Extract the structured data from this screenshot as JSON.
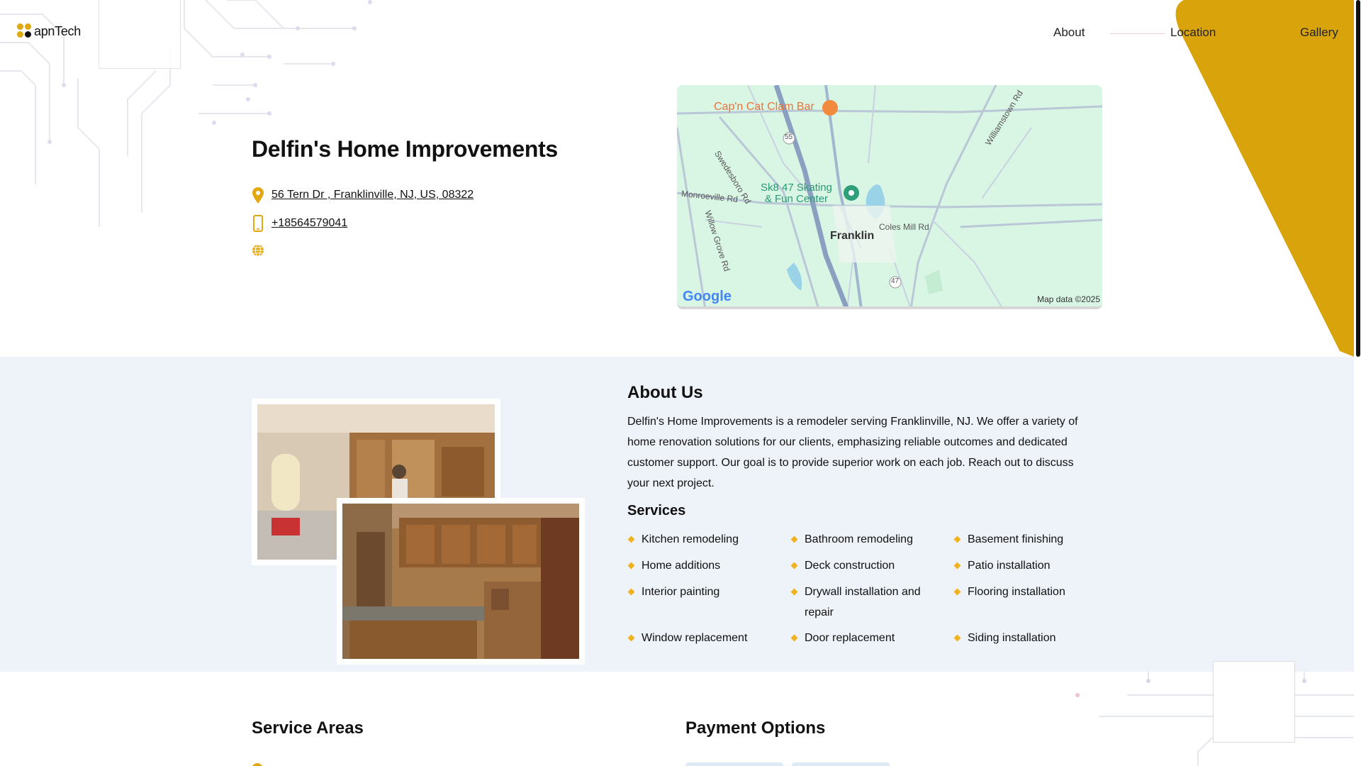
{
  "colors": {
    "accent": "#e1a80f",
    "band": "#eef2f9"
  },
  "header": {
    "logo_text": "apnTech",
    "nav": {
      "about": "About",
      "location": "Location",
      "gallery": "Gallery"
    }
  },
  "business": {
    "name": "Delfin's Home Improvements",
    "address": "56 Tern Dr , Franklinville, NJ, US, 08322",
    "phone": "+18564579041",
    "icons": {
      "address": "map-pin-icon",
      "phone": "phone-icon",
      "website": "globe-icon"
    }
  },
  "map": {
    "labels": {
      "poi1": "Cap'n Cat Clam Bar",
      "poi2_line1": "Sk8 47 Skating",
      "poi2_line2": "& Fun Center",
      "town": "Franklin",
      "road_swedesboro": "Swedesboro Rd",
      "road_williamstown": "Williamstown Rd",
      "road_monroeville": "Monroeville Rd",
      "road_willow": "Willow Grove Rd",
      "road_coles": "Coles Mill Rd",
      "shield_55": "55",
      "shield_47": "47"
    },
    "google": "Google",
    "attribution": "Map data ©2025"
  },
  "about": {
    "title": "About Us",
    "text": "Delfin's Home Improvements is a remodeler serving Franklinville, NJ. We offer a variety of home renovation solutions for our clients, emphasizing reliable outcomes and dedicated customer support. Our goal is to provide superior work on each job. Reach out to discuss your next project.",
    "services_title": "Services",
    "services": [
      "Kitchen remodeling",
      "Bathroom remodeling",
      "Basement finishing",
      "Home additions",
      "Deck construction",
      "Patio installation",
      "Interior painting",
      "Drywall installation and repair",
      "Flooring installation",
      "Window replacement",
      "Door replacement",
      "Siding installation"
    ]
  },
  "sections": {
    "service_areas": "Service Areas",
    "payment_options": "Payment Options"
  }
}
